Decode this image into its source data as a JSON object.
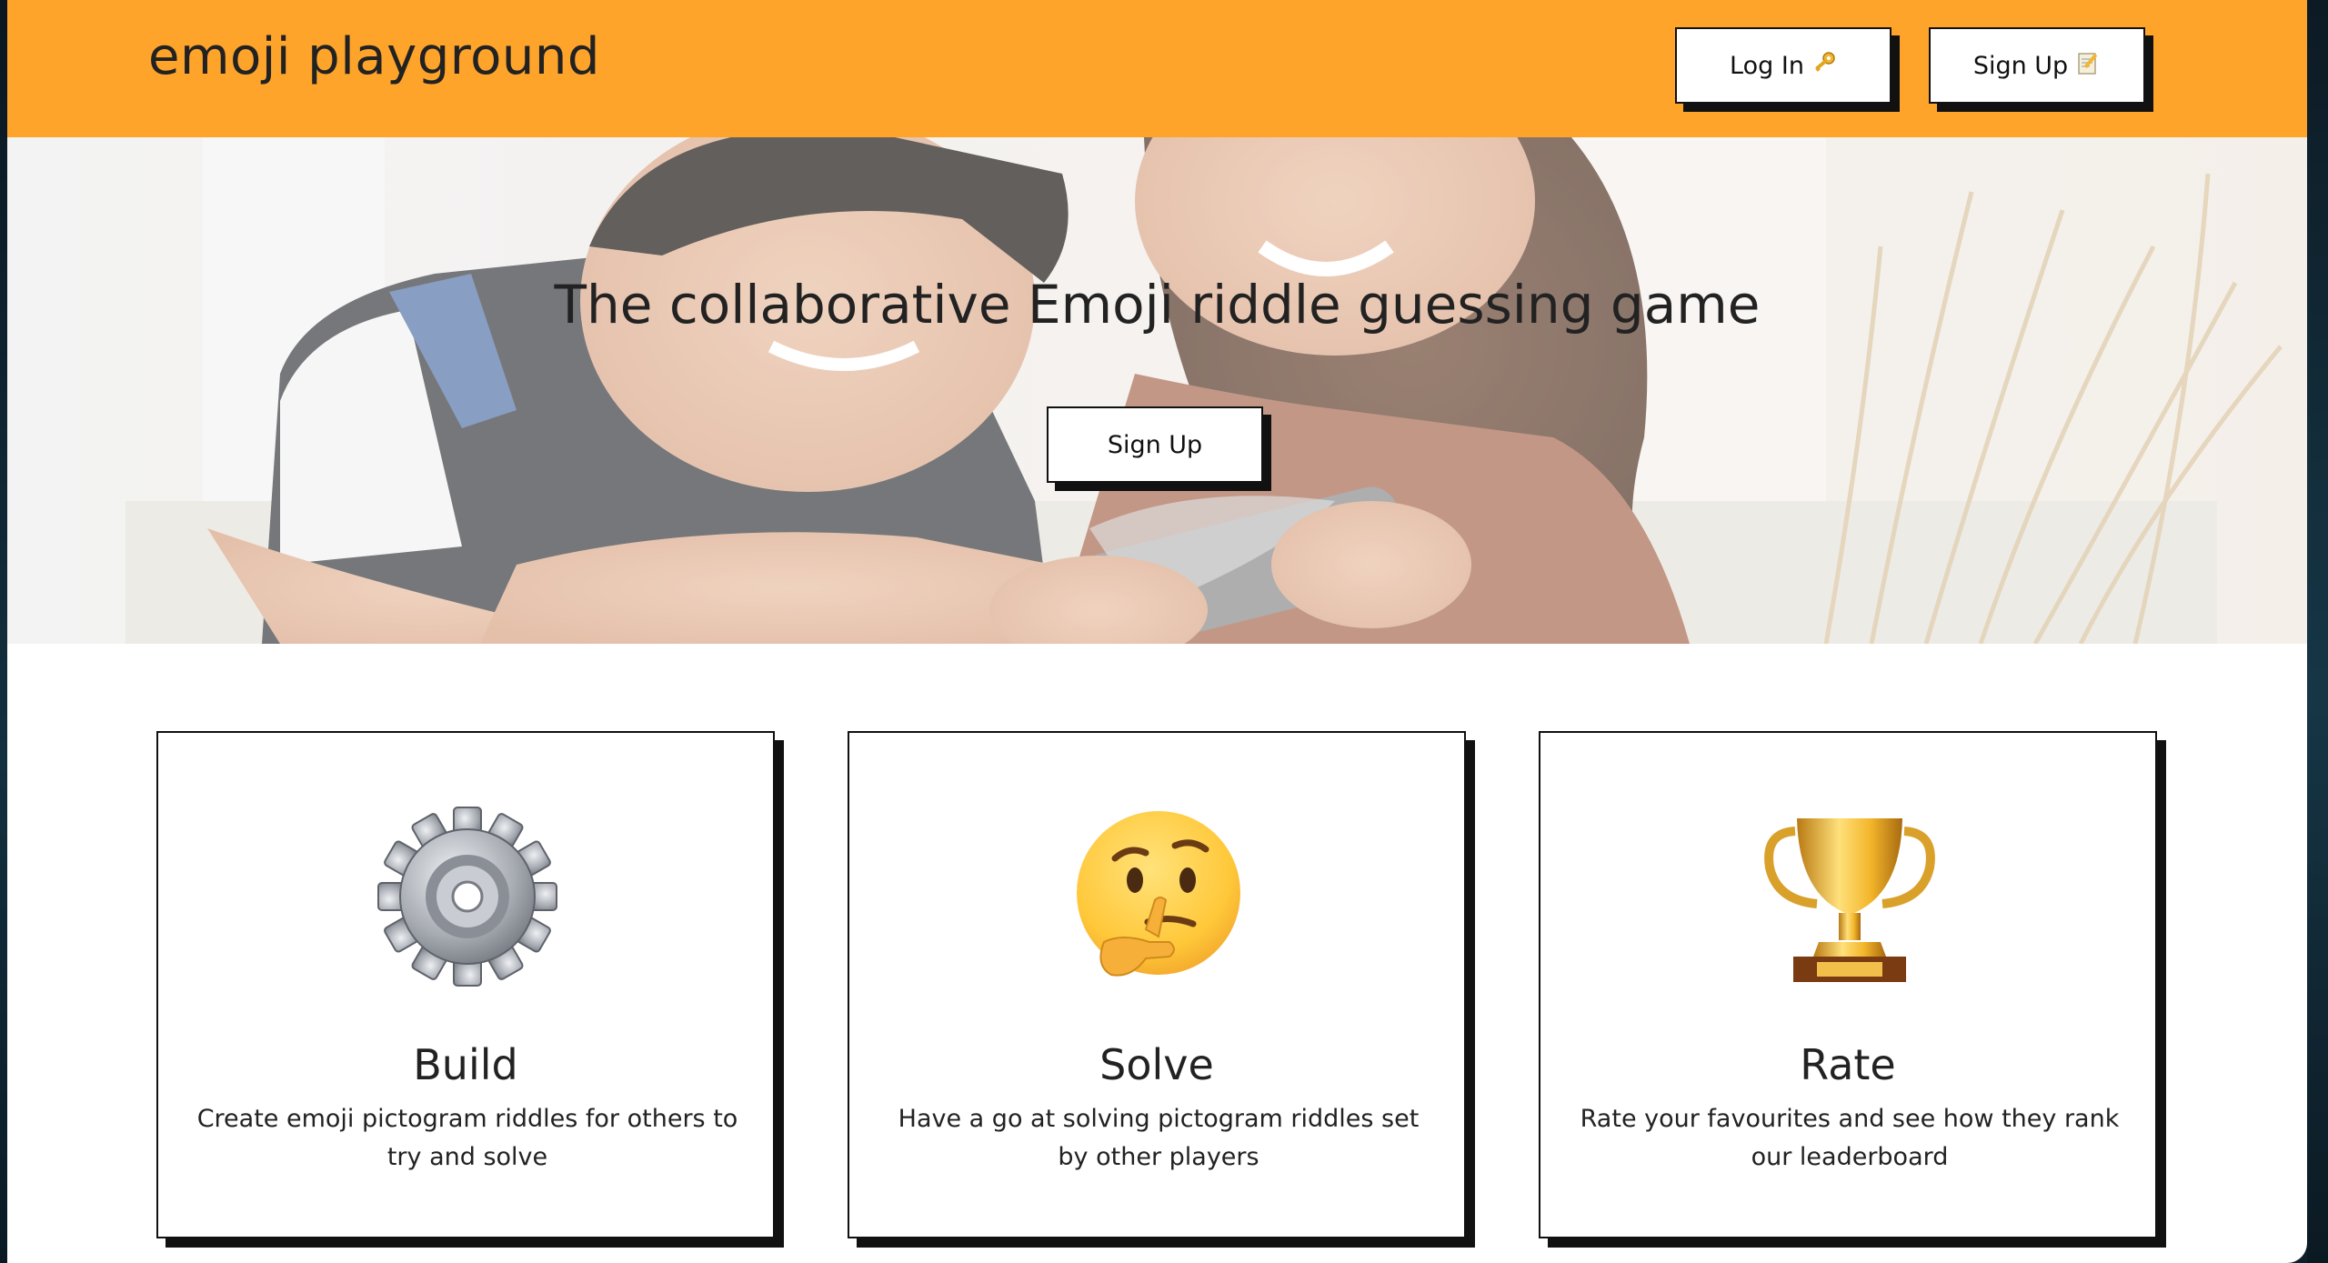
{
  "header": {
    "logo": "emoji playground",
    "login_label": "Log In",
    "login_icon": "key-icon",
    "signup_label": "Sign Up",
    "signup_icon": "memo-icon",
    "background_color": "#ffa42b"
  },
  "hero": {
    "title": "The collaborative Emoji riddle guessing game",
    "signup_label": "Sign Up"
  },
  "features": [
    {
      "icon": "gear-icon",
      "title": "Build",
      "description": "Create emoji pictogram riddles for others to try and solve"
    },
    {
      "icon": "thinking-face-icon",
      "title": "Solve",
      "description": "Have a go at solving pictogram riddles set by other players"
    },
    {
      "icon": "trophy-icon",
      "title": "Rate",
      "description": "Rate your favourites and see how they rank our leaderboard"
    }
  ]
}
